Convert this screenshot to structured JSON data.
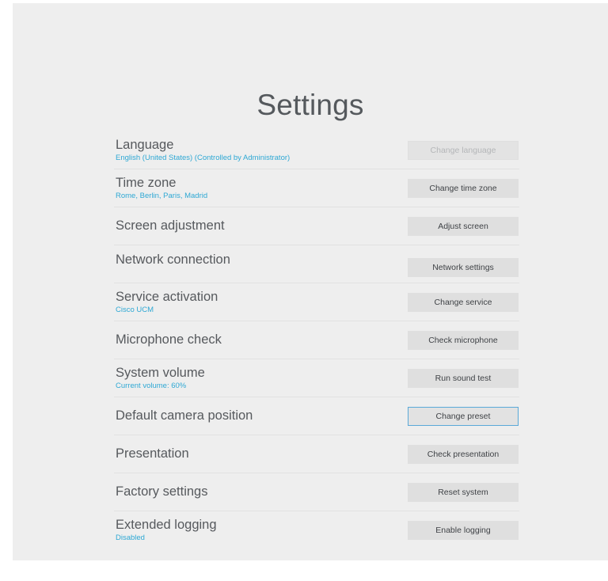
{
  "page": {
    "title": "Settings"
  },
  "colors": {
    "background": "#eeeeee",
    "subtext_accent": "#2ea8d4",
    "button_bg": "#dfdfdf",
    "focus_border": "#5aa9d8"
  },
  "settings": [
    {
      "label": "Language",
      "sub": "English (United States) (Controlled by Administrator)",
      "button": "Change language",
      "state": "disabled"
    },
    {
      "label": "Time zone",
      "sub": "Rome, Berlin, Paris, Madrid",
      "button": "Change time zone",
      "state": "normal"
    },
    {
      "label": "Screen adjustment",
      "sub": "",
      "button": "Adjust screen",
      "state": "normal"
    },
    {
      "label": "Network connection",
      "sub": "",
      "button": "Network settings",
      "state": "normal"
    },
    {
      "label": "Service activation",
      "sub": "Cisco UCM",
      "button": "Change service",
      "state": "normal"
    },
    {
      "label": "Microphone check",
      "sub": "",
      "button": "Check microphone",
      "state": "normal"
    },
    {
      "label": "System volume",
      "sub": "Current volume: 60%",
      "button": "Run sound test",
      "state": "normal"
    },
    {
      "label": "Default camera position",
      "sub": "",
      "button": "Change preset",
      "state": "focused"
    },
    {
      "label": "Presentation",
      "sub": "",
      "button": "Check presentation",
      "state": "normal"
    },
    {
      "label": "Factory settings",
      "sub": "",
      "button": "Reset system",
      "state": "normal"
    },
    {
      "label": "Extended logging",
      "sub": "Disabled",
      "button": "Enable logging",
      "state": "normal"
    }
  ]
}
